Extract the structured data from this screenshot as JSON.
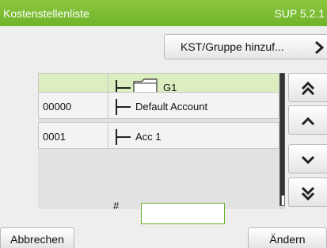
{
  "header": {
    "title": "Kostenstellenliste",
    "version": "SUP 5.2.1"
  },
  "toolbar": {
    "add_label": "KST/Gruppe hinzuf..."
  },
  "table": {
    "rows": [
      {
        "code": "",
        "name": "G1",
        "type": "folder",
        "selected": true
      },
      {
        "code": "00000",
        "name": "Default Account",
        "type": "account",
        "selected": false
      },
      {
        "code": "0001",
        "name": "Acc 1",
        "type": "account",
        "selected": false
      }
    ]
  },
  "nav": {
    "first_icon": "double-chevron-up-icon",
    "up_icon": "chevron-up-icon",
    "down_icon": "chevron-down-icon",
    "last_icon": "double-chevron-down-icon"
  },
  "input": {
    "label": "#",
    "value": ""
  },
  "footer": {
    "cancel_label": "Abbrechen",
    "change_label": "Ändern"
  },
  "colors": {
    "accent": "#7dbd35",
    "selected_row": "#dceec0"
  }
}
